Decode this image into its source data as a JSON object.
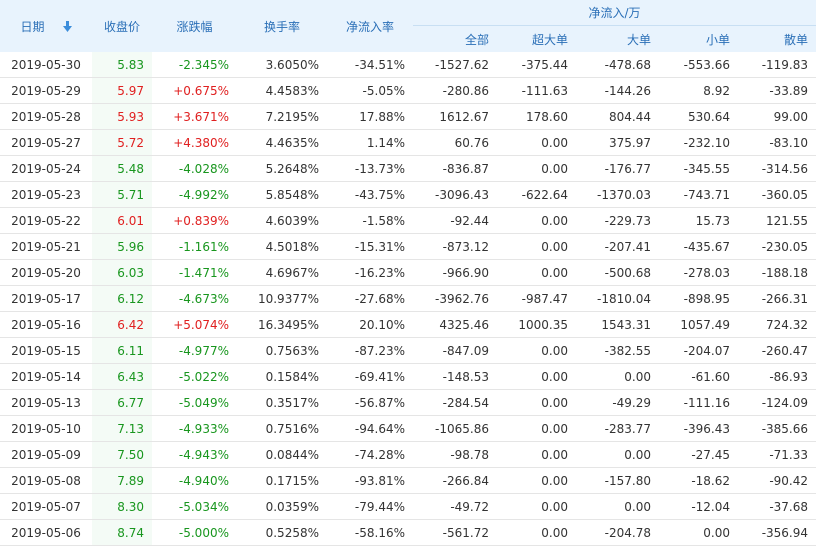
{
  "header": {
    "date": "日期",
    "close": "收盘价",
    "change": "涨跌幅",
    "turnover": "换手率",
    "net_rate": "净流入率",
    "group": "净流入/万",
    "all": "全部",
    "xl": "超大单",
    "large": "大单",
    "small": "小单",
    "retail": "散单",
    "sort_icon": "arrow-down-icon"
  },
  "colors": {
    "up": "#e02020",
    "down": "#18961e",
    "header_bg": "#e8f3fd",
    "header_text": "#2a6fb7"
  },
  "rows": [
    {
      "date": "2019-05-30",
      "close": "5.83",
      "change": "-2.345%",
      "turnover": "3.6050%",
      "net_rate": "-34.51%",
      "all": "-1527.62",
      "xl": "-375.44",
      "large": "-478.68",
      "small": "-553.66",
      "retail": "-119.83",
      "dir": "down"
    },
    {
      "date": "2019-05-29",
      "close": "5.97",
      "change": "+0.675%",
      "turnover": "4.4583%",
      "net_rate": "-5.05%",
      "all": "-280.86",
      "xl": "-111.63",
      "large": "-144.26",
      "small": "8.92",
      "retail": "-33.89",
      "dir": "up"
    },
    {
      "date": "2019-05-28",
      "close": "5.93",
      "change": "+3.671%",
      "turnover": "7.2195%",
      "net_rate": "17.88%",
      "all": "1612.67",
      "xl": "178.60",
      "large": "804.44",
      "small": "530.64",
      "retail": "99.00",
      "dir": "up"
    },
    {
      "date": "2019-05-27",
      "close": "5.72",
      "change": "+4.380%",
      "turnover": "4.4635%",
      "net_rate": "1.14%",
      "all": "60.76",
      "xl": "0.00",
      "large": "375.97",
      "small": "-232.10",
      "retail": "-83.10",
      "dir": "up"
    },
    {
      "date": "2019-05-24",
      "close": "5.48",
      "change": "-4.028%",
      "turnover": "5.2648%",
      "net_rate": "-13.73%",
      "all": "-836.87",
      "xl": "0.00",
      "large": "-176.77",
      "small": "-345.55",
      "retail": "-314.56",
      "dir": "down"
    },
    {
      "date": "2019-05-23",
      "close": "5.71",
      "change": "-4.992%",
      "turnover": "5.8548%",
      "net_rate": "-43.75%",
      "all": "-3096.43",
      "xl": "-622.64",
      "large": "-1370.03",
      "small": "-743.71",
      "retail": "-360.05",
      "dir": "down"
    },
    {
      "date": "2019-05-22",
      "close": "6.01",
      "change": "+0.839%",
      "turnover": "4.6039%",
      "net_rate": "-1.58%",
      "all": "-92.44",
      "xl": "0.00",
      "large": "-229.73",
      "small": "15.73",
      "retail": "121.55",
      "dir": "up"
    },
    {
      "date": "2019-05-21",
      "close": "5.96",
      "change": "-1.161%",
      "turnover": "4.5018%",
      "net_rate": "-15.31%",
      "all": "-873.12",
      "xl": "0.00",
      "large": "-207.41",
      "small": "-435.67",
      "retail": "-230.05",
      "dir": "down"
    },
    {
      "date": "2019-05-20",
      "close": "6.03",
      "change": "-1.471%",
      "turnover": "4.6967%",
      "net_rate": "-16.23%",
      "all": "-966.90",
      "xl": "0.00",
      "large": "-500.68",
      "small": "-278.03",
      "retail": "-188.18",
      "dir": "down"
    },
    {
      "date": "2019-05-17",
      "close": "6.12",
      "change": "-4.673%",
      "turnover": "10.9377%",
      "net_rate": "-27.68%",
      "all": "-3962.76",
      "xl": "-987.47",
      "large": "-1810.04",
      "small": "-898.95",
      "retail": "-266.31",
      "dir": "down"
    },
    {
      "date": "2019-05-16",
      "close": "6.42",
      "change": "+5.074%",
      "turnover": "16.3495%",
      "net_rate": "20.10%",
      "all": "4325.46",
      "xl": "1000.35",
      "large": "1543.31",
      "small": "1057.49",
      "retail": "724.32",
      "dir": "up"
    },
    {
      "date": "2019-05-15",
      "close": "6.11",
      "change": "-4.977%",
      "turnover": "0.7563%",
      "net_rate": "-87.23%",
      "all": "-847.09",
      "xl": "0.00",
      "large": "-382.55",
      "small": "-204.07",
      "retail": "-260.47",
      "dir": "down"
    },
    {
      "date": "2019-05-14",
      "close": "6.43",
      "change": "-5.022%",
      "turnover": "0.1584%",
      "net_rate": "-69.41%",
      "all": "-148.53",
      "xl": "0.00",
      "large": "0.00",
      "small": "-61.60",
      "retail": "-86.93",
      "dir": "down"
    },
    {
      "date": "2019-05-13",
      "close": "6.77",
      "change": "-5.049%",
      "turnover": "0.3517%",
      "net_rate": "-56.87%",
      "all": "-284.54",
      "xl": "0.00",
      "large": "-49.29",
      "small": "-111.16",
      "retail": "-124.09",
      "dir": "down"
    },
    {
      "date": "2019-05-10",
      "close": "7.13",
      "change": "-4.933%",
      "turnover": "0.7516%",
      "net_rate": "-94.64%",
      "all": "-1065.86",
      "xl": "0.00",
      "large": "-283.77",
      "small": "-396.43",
      "retail": "-385.66",
      "dir": "down"
    },
    {
      "date": "2019-05-09",
      "close": "7.50",
      "change": "-4.943%",
      "turnover": "0.0844%",
      "net_rate": "-74.28%",
      "all": "-98.78",
      "xl": "0.00",
      "large": "0.00",
      "small": "-27.45",
      "retail": "-71.33",
      "dir": "down"
    },
    {
      "date": "2019-05-08",
      "close": "7.89",
      "change": "-4.940%",
      "turnover": "0.1715%",
      "net_rate": "-93.81%",
      "all": "-266.84",
      "xl": "0.00",
      "large": "-157.80",
      "small": "-18.62",
      "retail": "-90.42",
      "dir": "down"
    },
    {
      "date": "2019-05-07",
      "close": "8.30",
      "change": "-5.034%",
      "turnover": "0.0359%",
      "net_rate": "-79.44%",
      "all": "-49.72",
      "xl": "0.00",
      "large": "0.00",
      "small": "-12.04",
      "retail": "-37.68",
      "dir": "down"
    },
    {
      "date": "2019-05-06",
      "close": "8.74",
      "change": "-5.000%",
      "turnover": "0.5258%",
      "net_rate": "-58.16%",
      "all": "-561.72",
      "xl": "0.00",
      "large": "-204.78",
      "small": "0.00",
      "retail": "-356.94",
      "dir": "down"
    }
  ]
}
